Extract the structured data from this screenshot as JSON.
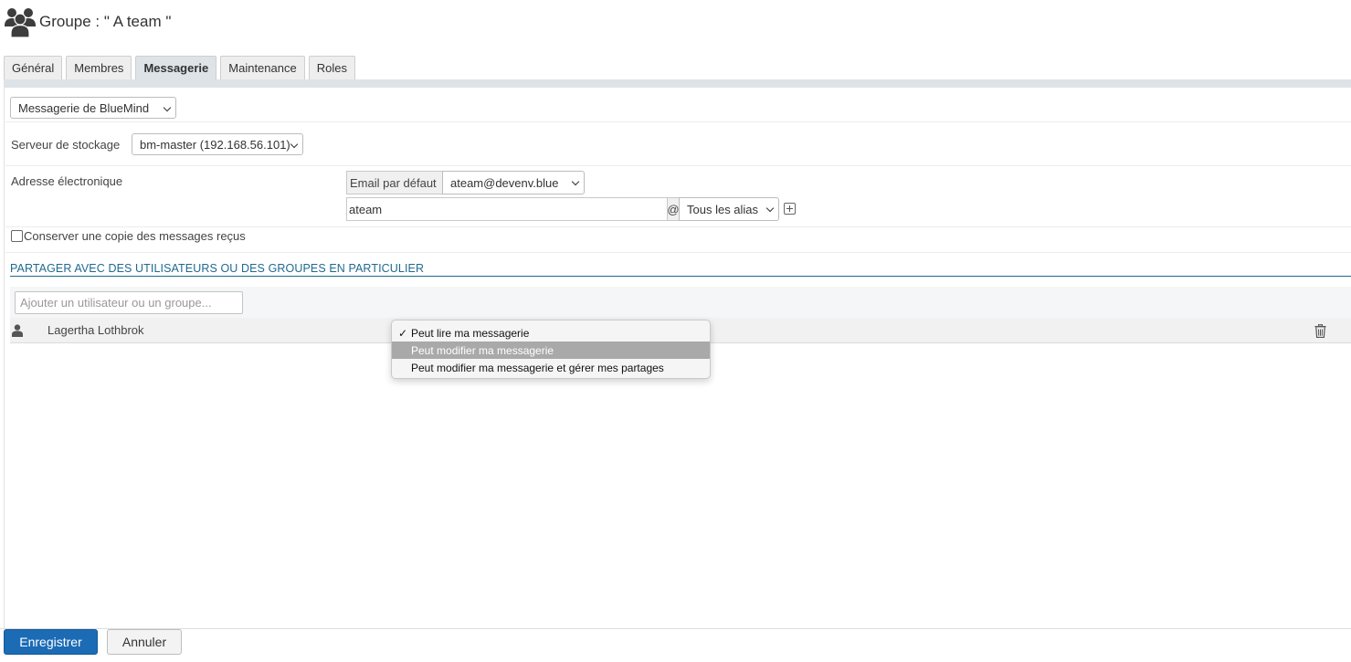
{
  "header": {
    "title": "Groupe : \" A team \""
  },
  "tabs": [
    {
      "label": "Général"
    },
    {
      "label": "Membres"
    },
    {
      "label": "Messagerie",
      "active": true
    },
    {
      "label": "Maintenance"
    },
    {
      "label": "Roles"
    }
  ],
  "mail": {
    "type_select": "Messagerie de BlueMind",
    "storage_label": "Serveur de stockage",
    "storage_select": "bm-master (192.168.56.101)",
    "address_label": "Adresse électronique",
    "default_email_addon": "Email par défaut",
    "default_email_select": "ateam@devenv.blue",
    "local_part_value": "ateam",
    "at_sign": "@",
    "alias_select": "Tous les alias",
    "keep_copy_label": "Conserver une copie des messages reçus"
  },
  "sharing": {
    "section_title": "PARTAGER AVEC DES UTILISATEURS OU DES GROUPES EN PARTICULIER",
    "add_placeholder": "Ajouter un utilisateur ou un groupe...",
    "users": [
      {
        "name": "Lagertha Lothbrok"
      }
    ],
    "dropdown": {
      "check_mark": "✓",
      "options": [
        {
          "label": "Peut lire ma messagerie",
          "checked": true
        },
        {
          "label": "Peut modifier ma messagerie",
          "highlighted": true
        },
        {
          "label": "Peut modifier ma messagerie et gérer mes partages"
        }
      ]
    }
  },
  "footer": {
    "save_label": "Enregistrer",
    "cancel_label": "Annuler"
  },
  "colors": {
    "accent": "#1b6bb5",
    "section_title": "#1f6a8f",
    "tab_active_bg": "#dde3e7"
  }
}
